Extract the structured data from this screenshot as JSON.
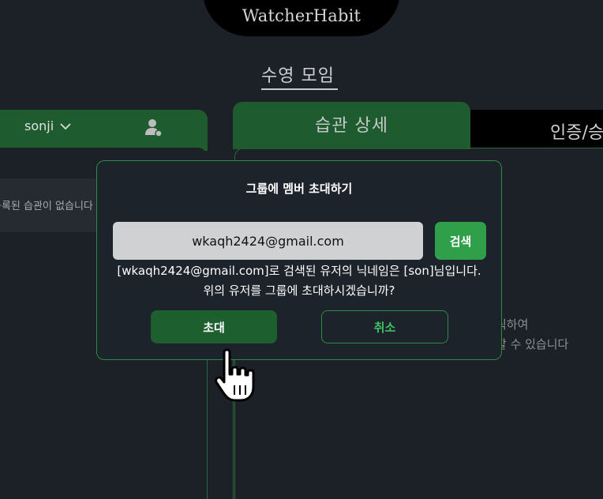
{
  "app": {
    "logo": "WatcherHabit"
  },
  "page": {
    "title": "수영 모임"
  },
  "left_panel": {
    "user_name": "sonji",
    "empty_text": "등록된 습관이 없습니다"
  },
  "middle_panel": {
    "tab_label": "습관 상세",
    "hint_line_1": "릭하여",
    "hint_line_2": "할 수 있습니다"
  },
  "right_panel": {
    "tab_label": "인증/승"
  },
  "dialog": {
    "title": "그룹에 멤버 초대하기",
    "email_value": "wkaqh2424@gmail.com",
    "search_label": "검색",
    "result_line_1": "[wkaqh2424@gmail.com]로 검색된 유저의 닉네임은 [son]님입니다.",
    "result_line_2": "위의 유저를 그룹에 초대하시겠습니까?",
    "invite_label": "초대",
    "cancel_label": "취소"
  },
  "colors": {
    "background": "#1b2127",
    "green_dark": "#1e5c2f",
    "green_accent": "#2f9f4a",
    "dialog_border": "#2f8a45"
  }
}
